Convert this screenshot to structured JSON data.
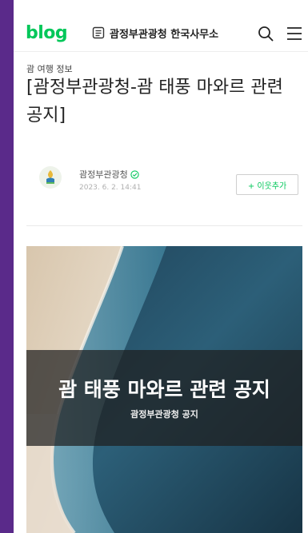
{
  "header": {
    "logo": "blog",
    "blog_name": "괌정부관광청 한국사무소",
    "icons": [
      "list-icon",
      "search-icon",
      "menu-icon"
    ]
  },
  "post": {
    "category": "괌 여행 정보",
    "title": "[괌정부관광청-괌 태풍 마와르 관련 공지]",
    "author": {
      "name": "괌정부관광청",
      "date": "2023. 6. 2. 14:41",
      "verified": true
    },
    "add_neighbor_label": "+ 이웃추가",
    "hero": {
      "title": "괌 태풍 마와르 관련 공지",
      "subtitle": "괌정부관광청 공지"
    }
  },
  "colors": {
    "frame_background": "#5a2a8a",
    "brand_green": "#03c75a"
  }
}
